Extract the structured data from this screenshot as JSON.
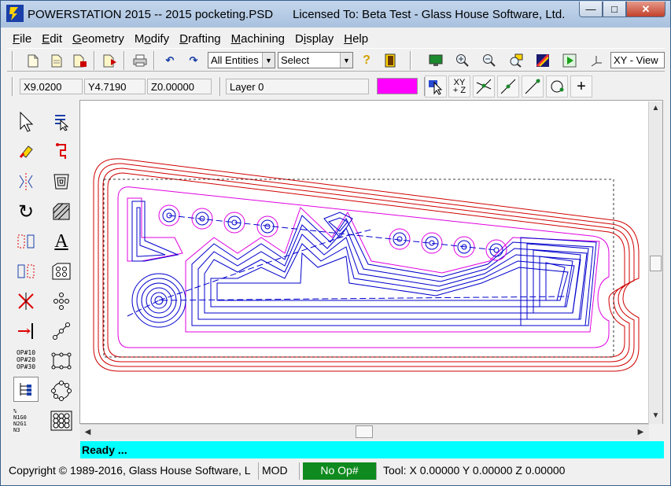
{
  "title": {
    "text": "POWERSTATION 2015 -- 2015 pocketing.PSD      Licensed To: Beta Test - Glass House Software, Ltd."
  },
  "window_controls": {
    "minimize": "—",
    "maximize": "□",
    "close": "✕"
  },
  "menu": [
    {
      "ul": "F",
      "rest": "ile"
    },
    {
      "ul": "E",
      "rest": "dit"
    },
    {
      "ul": "G",
      "rest": "eometry"
    },
    {
      "pre": "M",
      "ul": "o",
      "rest": "dify"
    },
    {
      "ul": "D",
      "rest": "rafting"
    },
    {
      "ul": "M",
      "rest": "achining"
    },
    {
      "pre": "D",
      "ul": "i",
      "rest": "splay"
    },
    {
      "ul": "H",
      "rest": "elp"
    }
  ],
  "toolbar": {
    "entities_filter": "All Entities",
    "select_mode": "Select",
    "view": "XY - View"
  },
  "coords": {
    "x": "X9.0200",
    "y": "Y4.7190",
    "z": "Z0.00000"
  },
  "layer": {
    "name": "Layer 0",
    "color": "#ff00ff"
  },
  "snap_labels": {
    "xyz_top": "XY",
    "xyz_bottom": "+ Z"
  },
  "palette_left": {
    "op_labels": [
      "OP#10",
      "OP#20",
      "OP#30"
    ],
    "nc_labels": [
      "%",
      "N1G0",
      "N2G1",
      "N3"
    ]
  },
  "status": {
    "ready": "Ready ...",
    "copyright": "Copyright © 1989-2016, Glass House Software, L",
    "mode": "MOD",
    "op": "No Op#",
    "tool": "Tool: X 0.00000 Y 0.00000 Z 0.00000"
  },
  "colors": {
    "red_path": "#d00000",
    "magenta_path": "#e000e0",
    "blue_path": "#0000cc",
    "accent_ready": "#00ffff",
    "op_green": "#0f8a1e"
  }
}
